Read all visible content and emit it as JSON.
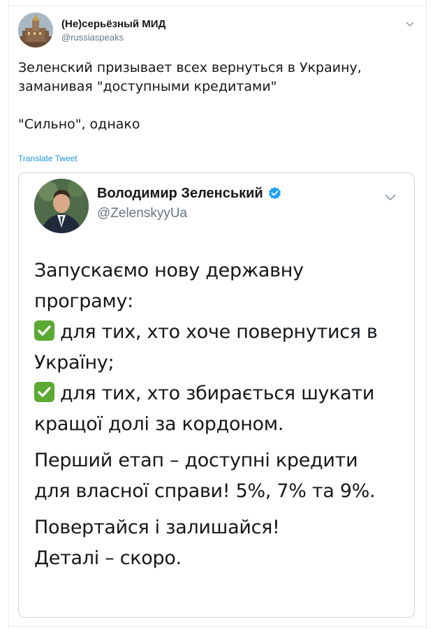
{
  "outer_tweet": {
    "author_name": "(Не)серьёзный МИД",
    "author_handle": "@russiaspeaks",
    "text_line1": "Зеленский призывает всех вернуться в Украину,\nзаманивая \"доступными кредитами\"",
    "text_line2": "\"Сильно\", однако",
    "translate_label": "Translate Tweet",
    "avatar_icon": "kremlin-building-avatar",
    "menu_icon": "chevron-down-icon"
  },
  "embedded_image": {
    "author_name": "Володимир Зеленський",
    "author_handle": "@ZelenskyyUa",
    "verified_icon": "verified-badge-icon",
    "menu_icon": "chevron-down-icon",
    "paragraphs": {
      "p1_line1": "Запускаємо нову державну",
      "p1_line2": "програму:",
      "item1_a": "для тих, хто хоче повернутися в",
      "item1_b": "Україну;",
      "item2_a": "для тих, хто збирається шукати",
      "item2_b": "кращої долі за кордоном.",
      "p2_line1": "Перший етап – доступні кредити",
      "p2_line2": "для власної справи! 5%, 7% та 9%.",
      "p3_line1": "Повертайся і залишайся!",
      "p3_line2": "Деталі – скоро."
    },
    "check_icon": "check-mark-button-icon"
  },
  "colors": {
    "link": "#1b95e0",
    "verified": "#1da1f2",
    "check_green": "#5ba832",
    "muted": "#657786",
    "border": "#e6ecf0"
  }
}
